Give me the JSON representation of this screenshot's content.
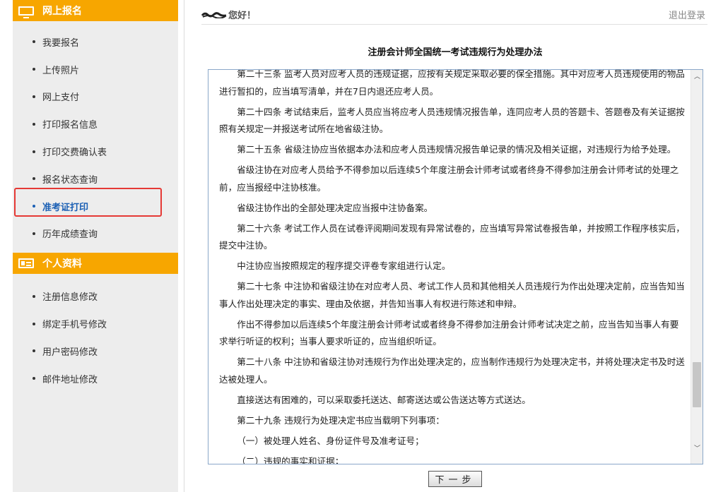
{
  "sidebar": {
    "section1": {
      "title": "网上报名",
      "icon": "monitor-icon",
      "items": [
        "我要报名",
        "上传照片",
        "网上支付",
        "打印报名信息",
        "打印交费确认表",
        "报名状态查询",
        "准考证打印",
        "历年成绩查询"
      ],
      "active_index": 6
    },
    "section2": {
      "title": "个人资料",
      "icon": "id-card-icon",
      "items": [
        "注册信息修改",
        "绑定手机号修改",
        "用户密码修改",
        "邮件地址修改"
      ]
    }
  },
  "header": {
    "greeting": "您好！",
    "logout": "退出登录"
  },
  "document": {
    "title": "注册会计师全国统一考试违规行为处理办法",
    "paragraphs": [
      "第二十三条 监考人员对应考人员的违规证据，应按有关规定采取必要的保全措施。其中对应考人员违规使用的物品进行暂扣的，应当填写清单，并在7日内退还应考人员。",
      "第二十四条 考试结束后，监考人员应当将应考人员违规情况报告单，连同应考人员的答题卡、答题卷及有关证据按照有关规定一并报送考试所在地省级注协。",
      "第二十五条 省级注协应当依据本办法和应考人员违规情况报告单记录的情况及相关证据，对违规行为给予处理。",
      "省级注协在对应考人员给予不得参加以后连续5个年度注册会计师考试或者终身不得参加注册会计师考试的处理之前，应当报经中注协核准。",
      "省级注协作出的全部处理决定应当报中注协备案。",
      "第二十六条 考试工作人员在试卷评阅期间发现有异常试卷的，应当填写异常试卷报告单，并按照工作程序核实后，提交中注协。",
      "中注协应当按照规定的程序提交评卷专家组进行认定。",
      "第二十七条 中注协和省级注协在对应考人员、考试工作人员和其他相关人员违规行为作出处理决定前，应当告知当事人作出处理决定的事实、理由及依据，并告知当事人有权进行陈述和申辩。",
      "作出不得参加以后连续5个年度注册会计师考试或者终身不得参加注册会计师考试决定之前，应当告知当事人有要求举行听证的权利；当事人要求听证的，应当组织听证。",
      "第二十八条 中注协和省级注协对违规行为作出处理决定的，应当制作违规行为处理决定书，并将处理决定书及时送达被处理人。",
      "直接送达有困难的，可以采取委托送达、邮寄送达或公告送达等方式送达。",
      "第二十九条 违规行为处理决定书应当载明下列事项：",
      "（一）被处理人姓名、身份证件号及准考证号；",
      "（二）违规的事实和证据；"
    ],
    "next_button": "下一步"
  },
  "colors": {
    "accent": "#f7a600",
    "active_link": "#1a5fb4",
    "highlight_box": "#e53935",
    "sidebar_bg": "#ededed"
  }
}
